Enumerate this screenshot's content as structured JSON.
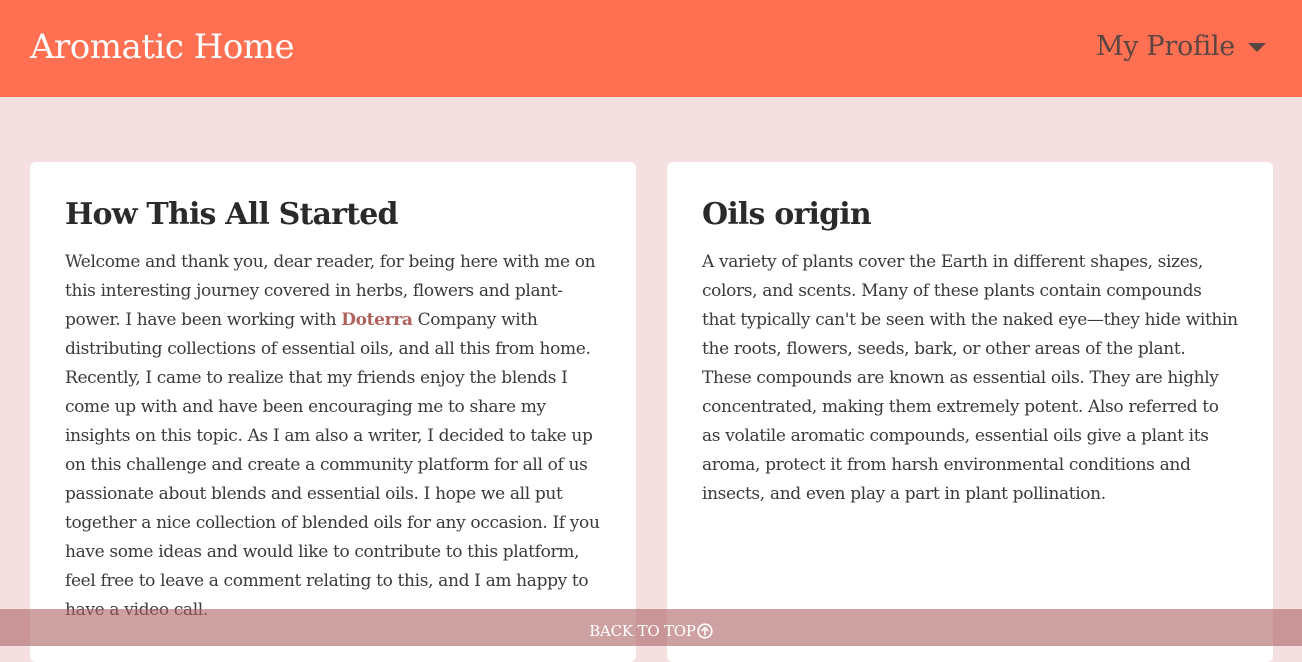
{
  "header": {
    "brand": "Aromatic Home",
    "profile_label": "My Profile",
    "profile_icon": "caret-down-icon"
  },
  "cards": [
    {
      "title": "How This All Started",
      "text_before_link": "Welcome and thank you, dear reader, for being here with me on this interesting journey covered in herbs, flowers and plant-power. I have been working with ",
      "link_text": "Doterra",
      "text_after_link": " Company with distributing collections of essential oils, and all this from home. Recently, I came to realize that my friends enjoy the blends I come up with and have been encouraging me to share my insights on this topic. As I am also a writer, I decided to take up on this challenge and create a community platform for all of us passionate about blends and essential oils. I hope we all put together a nice collection of blended oils for any occasion. If you have some ideas and would like to contribute to this platform, feel free to leave a comment relating to this, and I am happy to have a video call."
    },
    {
      "title": "Oils origin",
      "text": "A variety of plants cover the Earth in different shapes, sizes, colors, and scents. Many of these plants contain compounds that typically can't be seen with the naked eye—they hide within the roots, flowers, seeds, bark, or other areas of the plant. These compounds are known as essential oils. They are highly concentrated, making them extremely potent. Also referred to as volatile aromatic compounds, essential oils give a plant its aroma, protect it from harsh environmental conditions and insects, and even play a part in plant pollination."
    }
  ],
  "footer": {
    "back_to_top_label": "BACK TO TOP",
    "back_to_top_icon": "arrow-up-circle-icon"
  },
  "colors": {
    "navbar": "#ff7053",
    "page_background": "#f5e0e1",
    "link": "#b0625c",
    "footer_bar": "#ac6264"
  }
}
